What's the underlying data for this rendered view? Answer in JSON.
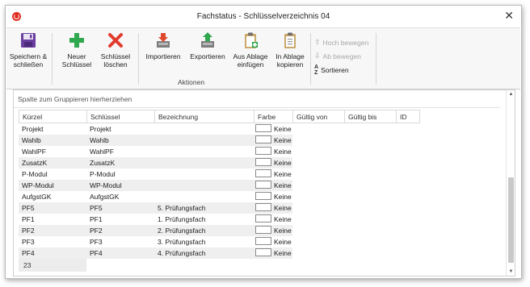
{
  "window": {
    "title": "Fachstatus - Schlüsselverzeichnis 04"
  },
  "ribbon": {
    "save": "Speichern & schließen",
    "new_key": "Neuer Schlüssel",
    "delete_key": "Schlüssel löschen",
    "import": "Importieren",
    "export": "Exportieren",
    "paste": "Aus Ablage einfügen",
    "copy": "In Ablage kopieren",
    "move_up": "Hoch bewegen",
    "move_down": "Ab bewegen",
    "sort": "Sortieren",
    "group_label": "Aktionen"
  },
  "grid": {
    "group_hint": "Spalte zum Gruppieren hierherziehen",
    "columns": [
      "Kürzel",
      "Schlüssel",
      "Bezeichnung",
      "Farbe",
      "Gültig von",
      "Gültig bis",
      "ID"
    ],
    "rows": [
      {
        "kuerzel": "Projekt",
        "schluessel": "Projekt",
        "bezeichnung": "",
        "farbe": "Keine"
      },
      {
        "kuerzel": "Wahlb",
        "schluessel": "Wahlb",
        "bezeichnung": "",
        "farbe": "Keine"
      },
      {
        "kuerzel": "WahlPF",
        "schluessel": "WahlPF",
        "bezeichnung": "",
        "farbe": "Keine"
      },
      {
        "kuerzel": "ZusatzK",
        "schluessel": "ZusatzK",
        "bezeichnung": "",
        "farbe": "Keine"
      },
      {
        "kuerzel": "P-Modul",
        "schluessel": "P-Modul",
        "bezeichnung": "",
        "farbe": "Keine"
      },
      {
        "kuerzel": "WP-Modul",
        "schluessel": "WP-Modul",
        "bezeichnung": "",
        "farbe": "Keine"
      },
      {
        "kuerzel": "AufgstGK",
        "schluessel": "AufgstGK",
        "bezeichnung": "",
        "farbe": "Keine"
      },
      {
        "kuerzel": "PF5",
        "schluessel": "PF5",
        "bezeichnung": "5. Prüfungsfach",
        "farbe": "Keine"
      },
      {
        "kuerzel": "PF1",
        "schluessel": "PF1",
        "bezeichnung": "1. Prüfungsfach",
        "farbe": "Keine"
      },
      {
        "kuerzel": "PF2",
        "schluessel": "PF2",
        "bezeichnung": "2. Prüfungsfach",
        "farbe": "Keine"
      },
      {
        "kuerzel": "PF3",
        "schluessel": "PF3",
        "bezeichnung": "3. Prüfungsfach",
        "farbe": "Keine"
      },
      {
        "kuerzel": "PF4",
        "schluessel": "PF4",
        "bezeichnung": "4. Prüfungsfach",
        "farbe": "Keine"
      }
    ],
    "count": "23"
  },
  "icons": {
    "app": "app-logo-icon",
    "save": "floppy-disk-icon",
    "new_key": "plus-icon",
    "delete_key": "x-icon",
    "import": "import-icon",
    "export": "export-icon",
    "paste": "clipboard-paste-icon",
    "copy": "clipboard-copy-icon",
    "move_up": "arrow-up-icon",
    "move_down": "arrow-down-icon",
    "sort": "sort-az-icon",
    "close": "close-icon"
  },
  "colors": {
    "accent_red": "#e02a1e",
    "save_purple": "#6b3fa0",
    "plus_green": "#2fa84f",
    "delete_red": "#e23b2e",
    "row_alt": "#efefef"
  }
}
